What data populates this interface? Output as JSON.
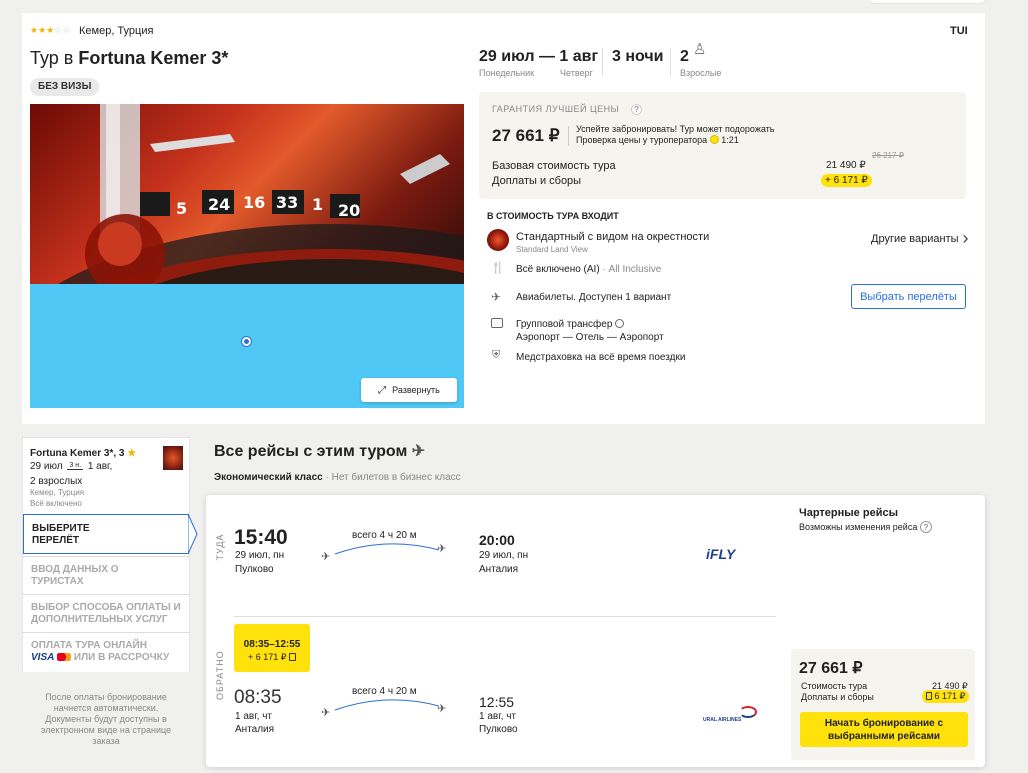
{
  "hotel": {
    "stars": 3,
    "location": "Кемер, Турция",
    "operator": "TUI",
    "title_prefix": "Тур в ",
    "title_name": "Fortuna Kemer 3*",
    "visa_badge": "БЕЗ ВИЗЫ",
    "expand_label": "Развернуть"
  },
  "dates": {
    "range": "29 июл — 1 авг",
    "nights": "3 ночи",
    "adults": "2",
    "from_day": "Понедельник",
    "to_day": "Четверг",
    "adults_label": "Взрослые"
  },
  "price_box": {
    "guarantee": "ГАРАНТИЯ ЛУЧШЕЙ ЦЕНЫ",
    "price": "27 661 ₽",
    "hurry1": "Успейте забронировать! Тур может подорожать",
    "hurry2": "Проверка цены у туроператора",
    "timer": "1:21",
    "base_label": "Базовая стоимость тура",
    "base_value": "21 490 ₽",
    "old_price": "26 217 ₽",
    "fees_label": "Доплаты и сборы",
    "fees_value": "+ 6 171 ₽"
  },
  "included": {
    "title": "В СТОИМОСТЬ ТУРА ВХОДИТ",
    "room": "Стандартный с видом на окрестности",
    "room_sub": "Standard Land View",
    "other_variants": "Другие варианты",
    "meal": "Всё включено (AI)",
    "meal_sub": "· All Inclusive",
    "flights": "Авиабилеты. Доступен 1 вариант",
    "choose_flights": "Выбрать перелёты",
    "transfer": "Групповой трансфер",
    "transfer_route": "Аэропорт — Отель — Аэропорт",
    "insurance": "Медстраховка на всё время поездки"
  },
  "sidebar": {
    "hotel": "Fortuna Kemer 3*, 3",
    "date_from": "29 июл",
    "nights_short": "3 н.",
    "date_to": "1 авг,",
    "guests": "2 взрослых",
    "location": "Кемер, Турция",
    "meal": "Всё включено",
    "steps": [
      "ВЫБЕРИТЕ ПЕРЕЛЁТ",
      "ВВОД ДАННЫХ О ТУРИСТАХ",
      "ВЫБОР СПОСОБА ОПЛАТЫ И ДОПОЛНИТЕЛЬНЫХ УСЛУГ",
      "ОПЛАТА ТУРА ОНЛАЙН",
      "VISA",
      "ИЛИ В РАССРОЧКУ"
    ],
    "note": "После оплаты бронирование начнется автоматически. Документы будут доступны в электронном виде на странице заказа"
  },
  "flights": {
    "heading": "Все рейсы с этим туром",
    "class_label": "Экономический класс",
    "class_note": "· Нет билетов в бизнес класс",
    "charter_title": "Чартерные рейсы",
    "charter_note": "Возможны изменения рейса",
    "outbound": {
      "dir": "ТУДА",
      "dep_time": "15:40",
      "dep_date": "29 июл, пн",
      "dep_city": "Пулково",
      "duration": "всего 4 ч 20 м",
      "arr_time": "20:00",
      "arr_date": "29 июл, пн",
      "arr_city": "Анталия",
      "airline": "iFLY"
    },
    "inbound": {
      "dir": "ОБРАТНО",
      "chip_time": "08:35–12:55",
      "chip_price": "+ 6 171 ₽",
      "dep_time": "08:35",
      "dep_date": "1 авг, чт",
      "dep_city": "Анталия",
      "duration": "всего 4 ч 20 м",
      "arr_time": "12:55",
      "arr_date": "1 авг, чт",
      "arr_city": "Пулково",
      "airline": "URAL AIRLINES"
    },
    "summary": {
      "price": "27 661 ₽",
      "tour_label": "Стоимость тура",
      "tour_value": "21 490 ₽",
      "fees_label": "Доплаты и сборы",
      "fees_value": "6 171 ₽",
      "book_label": "Начать бронирование с выбранными рейсами"
    }
  },
  "colors": {
    "accent": "#2a6fd6",
    "yellow": "#ffe20b",
    "sky": "#50c8f6"
  }
}
